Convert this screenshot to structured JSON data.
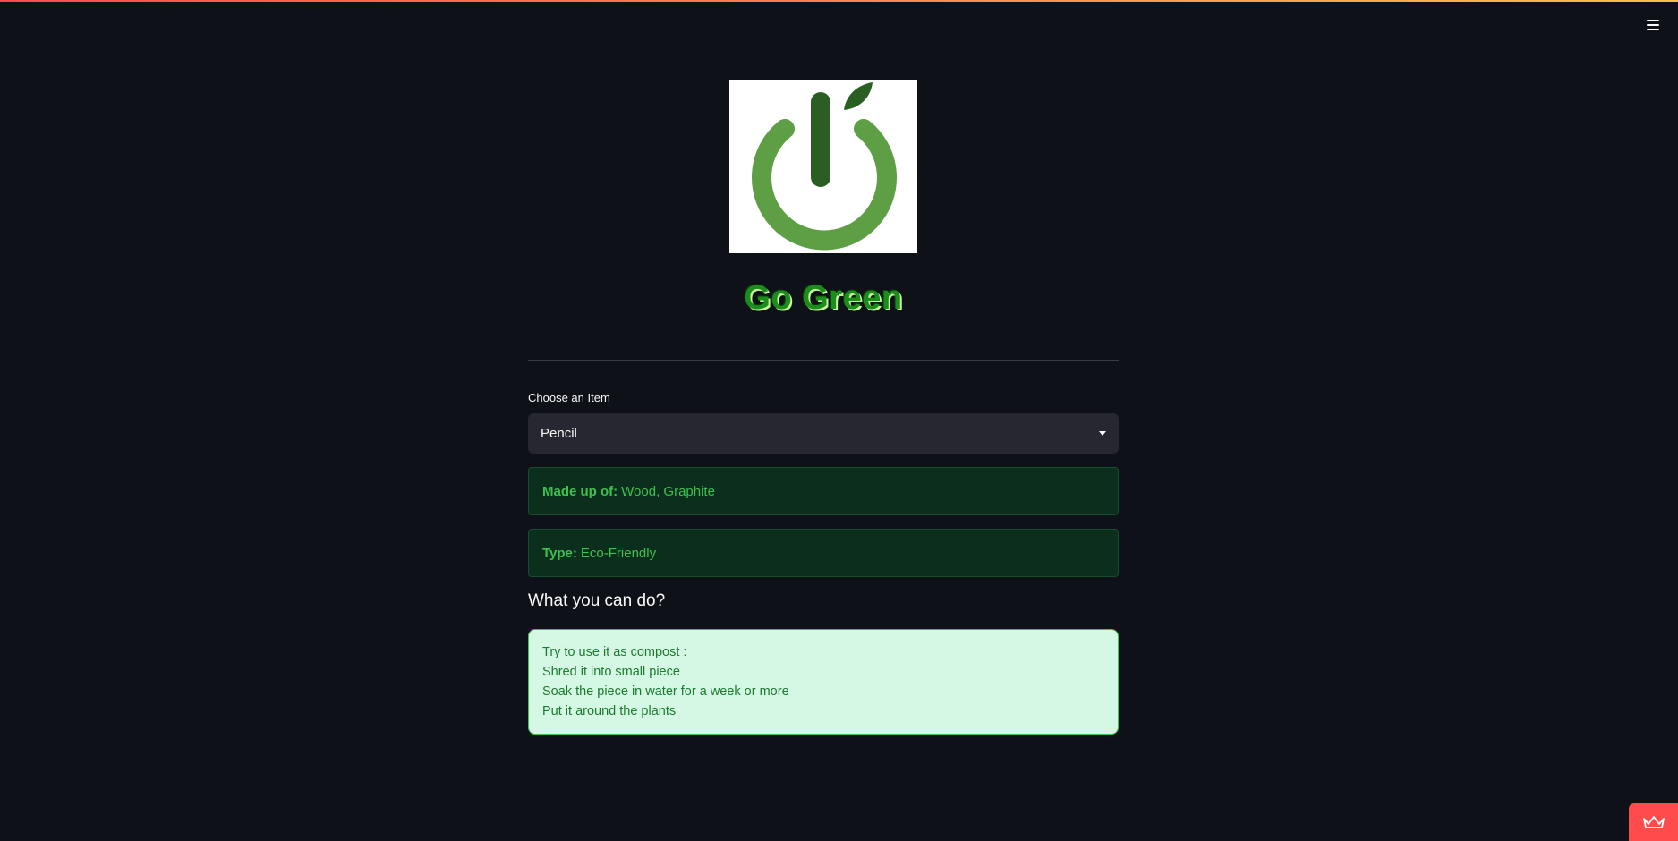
{
  "app": {
    "title": "Go Green",
    "accent_color": "#ff4b4b",
    "background_color": "#0e1117"
  },
  "header": {
    "menu_icon": "hamburger-menu-icon"
  },
  "logo": {
    "icon": "power-leaf-logo",
    "colors": {
      "ring": "#5e9e44",
      "leaf": "#2a5e22",
      "bar": "#2a5e22"
    }
  },
  "selector": {
    "label": "Choose an Item",
    "selected": "Pencil"
  },
  "info": {
    "made_up_of_label": "Made up of:",
    "made_up_of_value": "Wood, Graphite",
    "type_label": "Type:",
    "type_value": "Eco-Friendly"
  },
  "actions": {
    "heading": "What you can do?",
    "lines": [
      "Try to use it as compost :",
      "Shred it into small piece",
      "Soak the piece in water for a week or more",
      "Put it around the plants"
    ]
  },
  "footer": {
    "deploy_icon": "crown-icon"
  }
}
